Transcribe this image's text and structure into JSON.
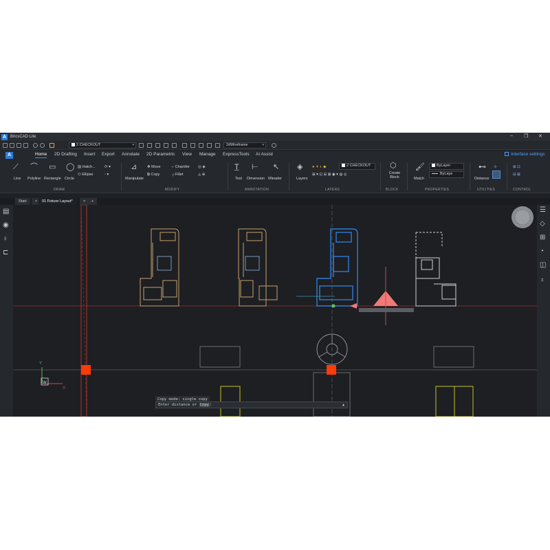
{
  "app": {
    "title": "BricsCAD Lite",
    "logo": "A"
  },
  "window_controls": {
    "minimize": "–",
    "maximize": "❐",
    "close": "✕"
  },
  "qat": {
    "layer_combo": "2 CHECKOUT",
    "visual_style": "2dWireframe"
  },
  "menu": {
    "tabs": [
      "Home",
      "2D Drafting",
      "Insert",
      "Export",
      "Annotate",
      "2D Parametric",
      "View",
      "Manage",
      "ExpressTools",
      "AI Assist"
    ],
    "active": "Home",
    "interface_settings": "Interface settings"
  },
  "ribbon": {
    "draw": {
      "line": "Line",
      "polyline": "Polyline",
      "rectangle": "Rectangle",
      "circle": "Circle",
      "hatch": "Hatch...",
      "ellipse": "Ellipse",
      "group": "DRAW"
    },
    "modify": {
      "manipulate": "Manipulate",
      "move": "Move",
      "copy": "Copy",
      "chamfer": "Chamfer",
      "fillet": "Fillet",
      "group": "MODIFY"
    },
    "annotation": {
      "text": "Text",
      "dimension": "Dimension",
      "mleader": "Mleader",
      "group": "ANNOTATION"
    },
    "layers": {
      "layers": "Layers",
      "current": "2 CHECKOUT",
      "group": "LAYERS"
    },
    "block": {
      "create_block": "Create Block",
      "group": "BLOCK"
    },
    "properties": {
      "match": "Match",
      "color": "ByLayer",
      "linetype": "ByLaye",
      "group": "PROPERTIES"
    },
    "utilities": {
      "distance": "Distance",
      "group": "UTILITIES"
    },
    "control": {
      "group": "CONTROL"
    }
  },
  "doc_tabs": {
    "start": "Start",
    "active": "01 Fixture Layout*",
    "close": "×",
    "add": "+"
  },
  "ucs": {
    "y": "Y",
    "x": "X",
    "w": "W"
  },
  "command": {
    "history": "Copy mode: single copy",
    "prompt_prefix": "Enter distance or ",
    "keyword": "Copy",
    "prompt_suffix": ":"
  },
  "colors": {
    "accent": "#2f7ddb",
    "selection": "#2f7ddb",
    "fixture": "#c8a06a",
    "axis": "#c0392b",
    "marker": "#ff3b0a",
    "gizmo": "#f07a78"
  }
}
